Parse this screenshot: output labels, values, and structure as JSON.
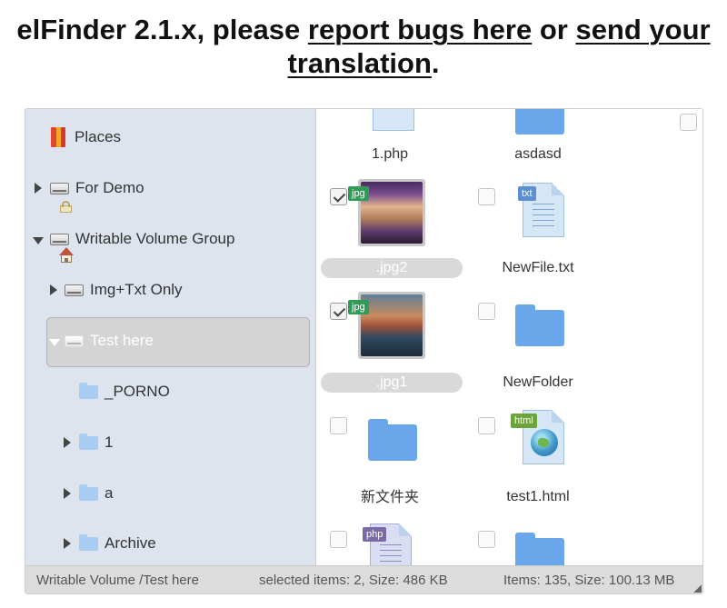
{
  "header": {
    "prefix": "elFinder 2.1.x, please ",
    "link_bugs": "report bugs here",
    "middle": " or ",
    "link_translation_1": "send your",
    "link_translation_2": "translation",
    "suffix": "."
  },
  "navbar": {
    "places": "Places",
    "for_demo": "For Demo",
    "writable_group": "Writable Volume Group",
    "img_txt": "Img+Txt Only",
    "test_here": "Test here",
    "porno": "_PORNO",
    "folder_1": "1",
    "folder_a": "a",
    "archive": "Archive"
  },
  "files": {
    "php1": "1.php",
    "asdasd": "asdasd",
    "jpg2": ".jpg2",
    "newfile": "NewFile.txt",
    "jpg1": ".jpg1",
    "newfolder": "NewFolder",
    "cn_folder": "新文件夹",
    "test1": "test1.html"
  },
  "badges": {
    "jpg": "jpg",
    "txt": "txt",
    "html": "html",
    "php": "php"
  },
  "status": {
    "path": "Writable Volume /Test here",
    "selected": "selected items: 2, Size: 486 KB",
    "total": "Items: 135, Size: 100.13 MB"
  },
  "colors": {
    "navbar_bg": "#dde4ed",
    "folder_blue": "#6aa6ea",
    "jpg_badge": "#2e9b57",
    "txt_badge": "#5b8fd1",
    "html_badge": "#6aa43a",
    "php_badge": "#7a6aa6"
  }
}
